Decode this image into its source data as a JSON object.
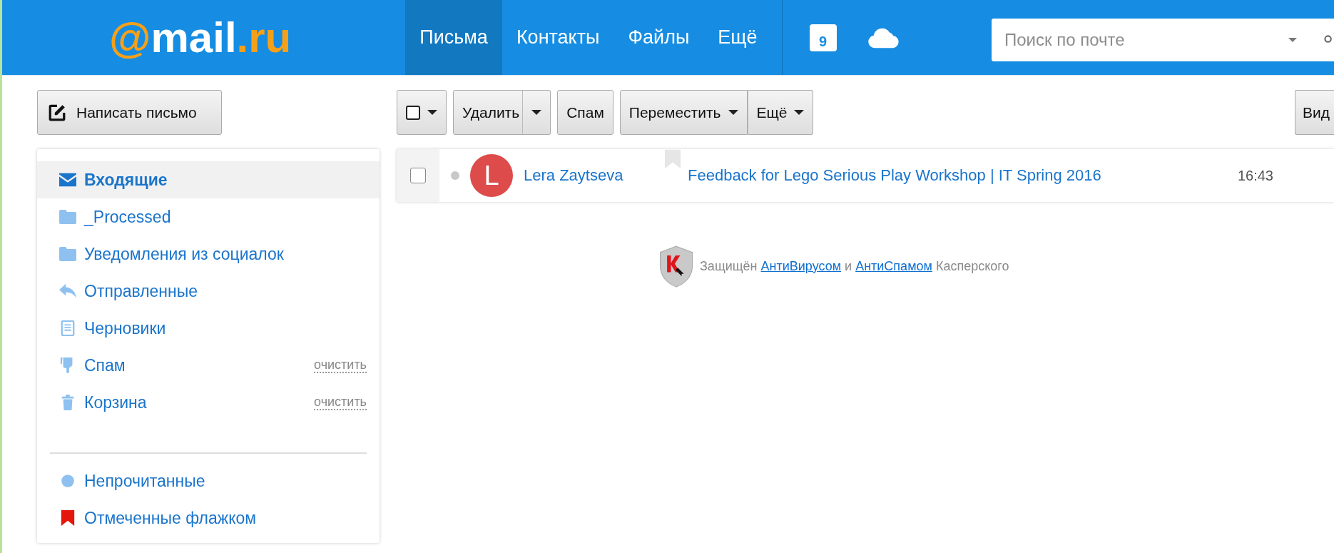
{
  "header": {
    "logo": [
      {
        "text": "@",
        "color": "#f6a01a"
      },
      {
        "text": "mail",
        "color": "#ffffff"
      },
      {
        "text": ".ru",
        "color": "#f6a01a"
      }
    ],
    "nav": [
      {
        "label": "Письма",
        "selected": true
      },
      {
        "label": "Контакты",
        "selected": false
      },
      {
        "label": "Файлы",
        "selected": false
      },
      {
        "label": "Ещё",
        "selected": false
      }
    ],
    "calendar_day": "9",
    "search": {
      "placeholder": "Поиск по почте"
    }
  },
  "compose_button": "Написать письмо",
  "sidebar": {
    "folders": [
      {
        "label": "Входящие",
        "kind": "envelope",
        "selected": true
      },
      {
        "label": "_Processed",
        "kind": "folder",
        "selected": false
      },
      {
        "label": "Уведомления из социалок",
        "kind": "folder",
        "selected": false
      },
      {
        "label": "Отправленные",
        "kind": "reply",
        "selected": false
      },
      {
        "label": "Черновики",
        "kind": "draft",
        "selected": false
      },
      {
        "label": "Спам",
        "kind": "thumbdown",
        "selected": false,
        "action": "очистить"
      },
      {
        "label": "Корзина",
        "kind": "trash",
        "selected": false,
        "action": "очистить"
      }
    ],
    "filters": [
      {
        "label": "Непрочитанные",
        "kind": "dot"
      },
      {
        "label": "Отмеченные флажком",
        "kind": "flag"
      }
    ]
  },
  "toolbar": [
    {
      "kind": "checkbox",
      "checked": false
    },
    {
      "kind": "split",
      "label": "Удалить"
    },
    {
      "kind": "plain",
      "label": "Спам"
    },
    {
      "kind": "dropdown",
      "label": "Переместить"
    },
    {
      "kind": "dropdown",
      "label": "Ещё",
      "attached": true
    }
  ],
  "view_button": "Вид",
  "messages": [
    {
      "checked": false,
      "unread": false,
      "avatar_letter": "L",
      "sender": "Lera Zaytseva",
      "flagged": false,
      "subject": "Feedback for Lego Serious Play Workshop | IT Spring 2016",
      "time": "16:43"
    }
  ],
  "protection": {
    "parts": [
      {
        "kind": "text",
        "text": "Защищён"
      },
      {
        "kind": "link",
        "text": "АнтиВирусом"
      },
      {
        "kind": "text",
        "text": "и"
      },
      {
        "kind": "link",
        "text": "АнтиСпамом"
      },
      {
        "kind": "text",
        "text": "Касперского"
      }
    ]
  }
}
